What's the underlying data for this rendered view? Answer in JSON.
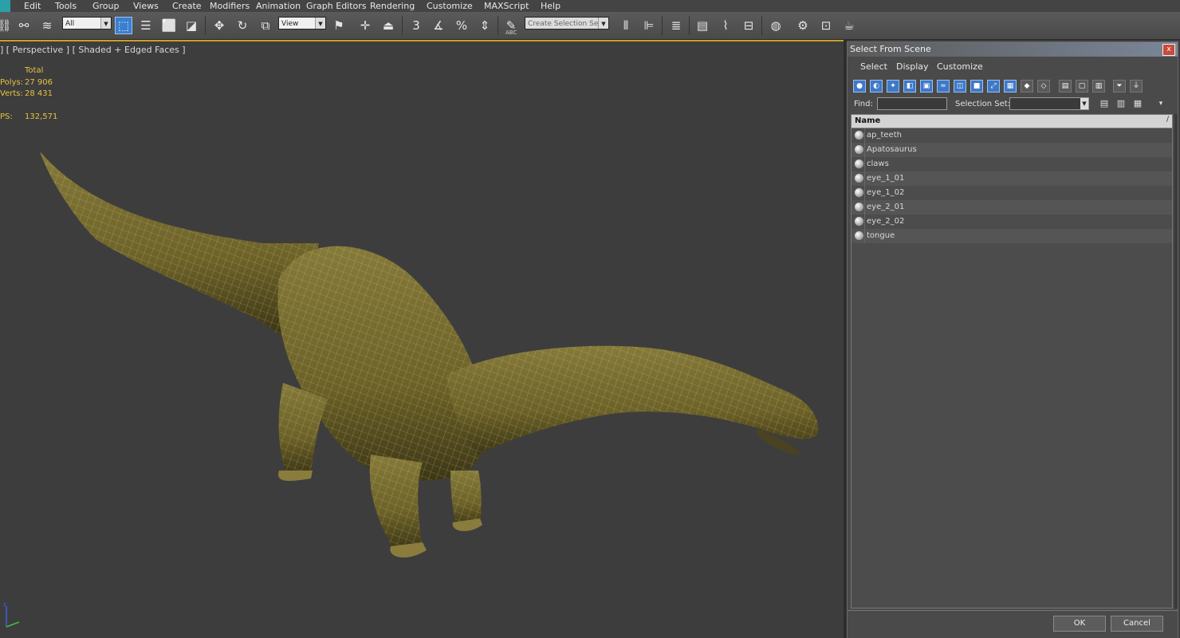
{
  "menubar": {
    "items": [
      "Edit",
      "Tools",
      "Group",
      "Views",
      "Create",
      "Modifiers",
      "Animation",
      "Graph Editors",
      "Rendering",
      "Customize",
      "MAXScript",
      "Help"
    ]
  },
  "toolbar": {
    "selection_filter": "All",
    "reference_coord": "View",
    "named_selection_placeholder": "Create Selection Se",
    "snap_label": "3",
    "percent_snap": "%",
    "text_small": "ABC"
  },
  "viewport": {
    "label": "] [ Perspective ] [ Shaded + Edged Faces ]",
    "stats": {
      "header": "Total",
      "polys_label": "Polys:",
      "polys_value": "27 906",
      "verts_label": "Verts:",
      "verts_value": "28 431",
      "fps_label": "PS:",
      "fps_value": "132,571"
    }
  },
  "dialog": {
    "title": "Select From Scene",
    "close": "x",
    "menu": [
      "Select",
      "Display",
      "Customize"
    ],
    "find_label": "Find:",
    "find_value": "",
    "selection_set_label": "Selection Set:",
    "selection_set_value": "",
    "list_header": "Name",
    "sort_icon": "/",
    "objects": [
      "ap_teeth",
      "Apatosaurus",
      "claws",
      "eye_1_01",
      "eye_1_02",
      "eye_2_01",
      "eye_2_02",
      "tongue"
    ],
    "ok_label": "OK",
    "cancel_label": "Cancel"
  },
  "colors": {
    "accent": "#3a7fd0",
    "viewport_border": "#c8a028",
    "stats_text": "#e8c040",
    "background": "#3d3d3d"
  }
}
